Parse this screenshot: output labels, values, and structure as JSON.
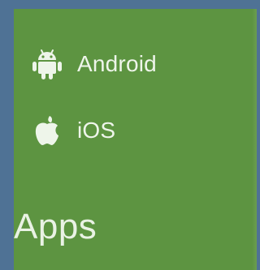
{
  "menu": {
    "items": [
      {
        "label": "Android",
        "icon": "android-icon"
      },
      {
        "label": "iOS",
        "icon": "apple-icon"
      }
    ]
  },
  "section": {
    "title": "Apps"
  },
  "colors": {
    "background": "#4f7295",
    "panel": "#5d9441",
    "text": "#eef5ea"
  }
}
